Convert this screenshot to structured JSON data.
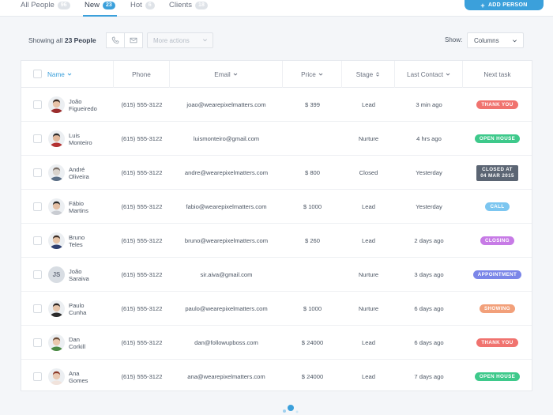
{
  "tabs": [
    {
      "label": "All People",
      "count": "96",
      "active": false
    },
    {
      "label": "New",
      "count": "23",
      "active": true
    },
    {
      "label": "Hot",
      "count": "6",
      "active": false
    },
    {
      "label": "Clients",
      "count": "18",
      "active": false
    }
  ],
  "add_button": {
    "label": "ADD PERSON",
    "icon": "plus-icon"
  },
  "toolbar": {
    "showing_prefix": "Showing all",
    "showing_count": "23 People",
    "phone_icon": "phone-icon",
    "email_icon": "envelope-icon",
    "more_actions_placeholder": "More actions",
    "show_label": "Show:",
    "columns_value": "Columns"
  },
  "columns": [
    "Name",
    "Phone",
    "Email",
    "Price",
    "Stage",
    "Last Contact",
    "Next task"
  ],
  "rows": [
    {
      "first": "João",
      "last": "Figueiredo",
      "phone": "(615) 555-3122",
      "email": "joao@wearepixelmatters.com",
      "price": "$ 399",
      "stage": "Lead",
      "last_contact": "3 min ago",
      "task": "THANK YOU",
      "task_color": "#f0736f",
      "avatar": "photo"
    },
    {
      "first": "Luis",
      "last": "Monteiro",
      "phone": "(615) 555-3122",
      "email": "luismonteiro@gmail.com",
      "price": "",
      "stage": "Nurture",
      "last_contact": "4 hrs ago",
      "task": "OPEN HOUSE",
      "task_color": "#3ec98b",
      "avatar": "photo"
    },
    {
      "first": "André",
      "last": "Oliveira",
      "phone": "(615) 555-3122",
      "email": "andre@wearepixelmatters.com",
      "price": "$ 800",
      "stage": "Closed",
      "last_contact": "Yesterday",
      "task": "CLOSED AT",
      "task2": "04 MAR 2015",
      "task_color": "#5b6573",
      "avatar": "photo"
    },
    {
      "first": "Fábio",
      "last": "Martins",
      "phone": "(615) 555-3122",
      "email": "fabio@wearepixelmatters.com",
      "price": "$ 1000",
      "stage": "Lead",
      "last_contact": "Yesterday",
      "task": "CALL",
      "task_color": "#7cc6f0",
      "avatar": "photo"
    },
    {
      "first": "Bruno",
      "last": "Teles",
      "phone": "(615) 555-3122",
      "email": "bruno@wearepixelmatters.com",
      "price": "$ 260",
      "stage": "Lead",
      "last_contact": "2 days ago",
      "task": "CLOSING",
      "task_color": "#c77be6",
      "avatar": "photo"
    },
    {
      "first": "João",
      "last": "Saraiva",
      "phone": "(615) 555-3122",
      "email": "sir.aiva@gmail.com",
      "price": "",
      "stage": "Nurture",
      "last_contact": "3 days ago",
      "task": "APPOINTMENT",
      "task_color": "#7b86e8",
      "avatar": "JS"
    },
    {
      "first": "Paulo",
      "last": "Cunha",
      "phone": "(615) 555-3122",
      "email": "paulo@wearepixelmatters.com",
      "price": "$ 1000",
      "stage": "Nurture",
      "last_contact": "6 days ago",
      "task": "SHOWING",
      "task_color": "#f2a07a",
      "avatar": "photo"
    },
    {
      "first": "Dan",
      "last": "Corkill",
      "phone": "(615) 555-3122",
      "email": "dan@followupboss.com",
      "price": "$ 24000",
      "stage": "Lead",
      "last_contact": "6 days ago",
      "task": "THANK YOU",
      "task_color": "#f0736f",
      "avatar": "photo"
    },
    {
      "first": "Ana",
      "last": "Gomes",
      "phone": "(615) 555-3122",
      "email": "ana@wearepixelmatters.com",
      "price": "$ 24000",
      "stage": "Lead",
      "last_contact": "7 days ago",
      "task": "OPEN HOUSE",
      "task_color": "#3ec98b",
      "avatar": "photo"
    }
  ],
  "colors": {
    "accent": "#3ba0db",
    "background": "#f4f6f9"
  }
}
